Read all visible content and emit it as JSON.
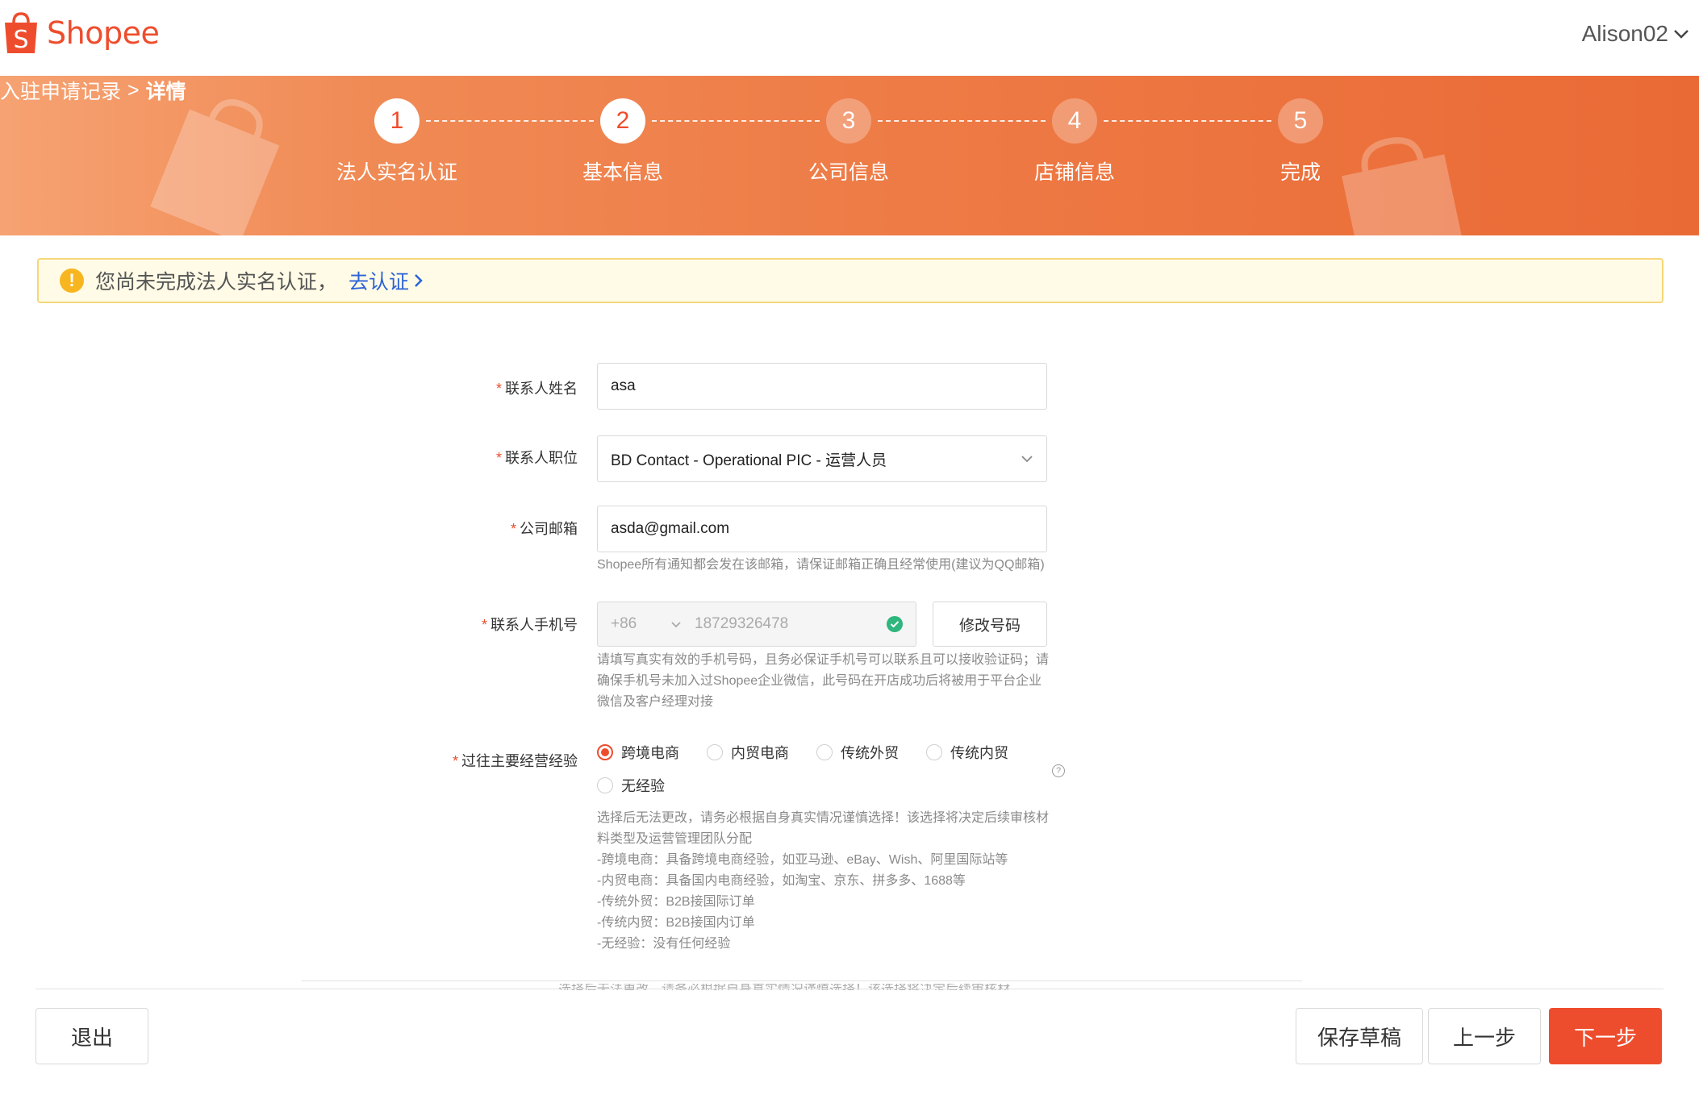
{
  "header": {
    "brand": "Shopee",
    "user": "Alison02"
  },
  "breadcrumb": {
    "parent": "入驻申请记录",
    "separator": ">",
    "current": "详情"
  },
  "steps": [
    {
      "num": "1",
      "label": "法人实名认证"
    },
    {
      "num": "2",
      "label": "基本信息"
    },
    {
      "num": "3",
      "label": "公司信息"
    },
    {
      "num": "4",
      "label": "店铺信息"
    },
    {
      "num": "5",
      "label": "完成"
    }
  ],
  "alert": {
    "icon": "!",
    "text": "您尚未完成法人实名认证，",
    "link": "去认证"
  },
  "form": {
    "name": {
      "label": "联系人姓名",
      "value": "asa"
    },
    "position": {
      "label": "联系人职位",
      "value": "BD Contact - Operational PIC - 运营人员"
    },
    "email": {
      "label": "公司邮箱",
      "value": "asda@gmail.com",
      "hint": "Shopee所有通知都会发在该邮箱，请保证邮箱正确且经常使用(建议为QQ邮箱)"
    },
    "phone": {
      "label": "联系人手机号",
      "country_code": "+86",
      "number": "18729326478",
      "modify_button": "修改号码",
      "hint": "请填写真实有效的手机号码，且务必保证手机号可以联系且可以接收验证码；请确保手机号未加入过Shopee企业微信，此号码在开店成功后将被用于平台企业微信及客户经理对接"
    },
    "experience": {
      "label": "过往主要经营经验",
      "options": [
        "跨境电商",
        "内贸电商",
        "传统外贸",
        "传统内贸",
        "无经验"
      ],
      "selected": "跨境电商",
      "help_icon": "?",
      "hint_lines": [
        "选择后无法更改，请务必根据自身真实情况谨慎选择！该选择将决定后续审核材",
        "料类型及运营管理团队分配",
        "-跨境电商：具备跨境电商经验，如亚马逊、eBay、Wish、阿里国际站等",
        "-内贸电商：具备国内电商经验，如淘宝、京东、拼多多、1688等",
        "-传统外贸：B2B接国际订单",
        "-传统内贸：B2B接国内订单",
        "-无经验：没有任何经验"
      ],
      "cut_text": "选择后无法更改，请务必根据自身真实情况谨慎选择！该选择将决定后续审核材"
    }
  },
  "footer": {
    "exit": "退出",
    "save_draft": "保存草稿",
    "prev": "上一步",
    "next": "下一步"
  },
  "colors": {
    "brand": "#ee4d2d",
    "link": "#2b62d9",
    "success": "#2eb67d",
    "warning": "#f7b520"
  }
}
